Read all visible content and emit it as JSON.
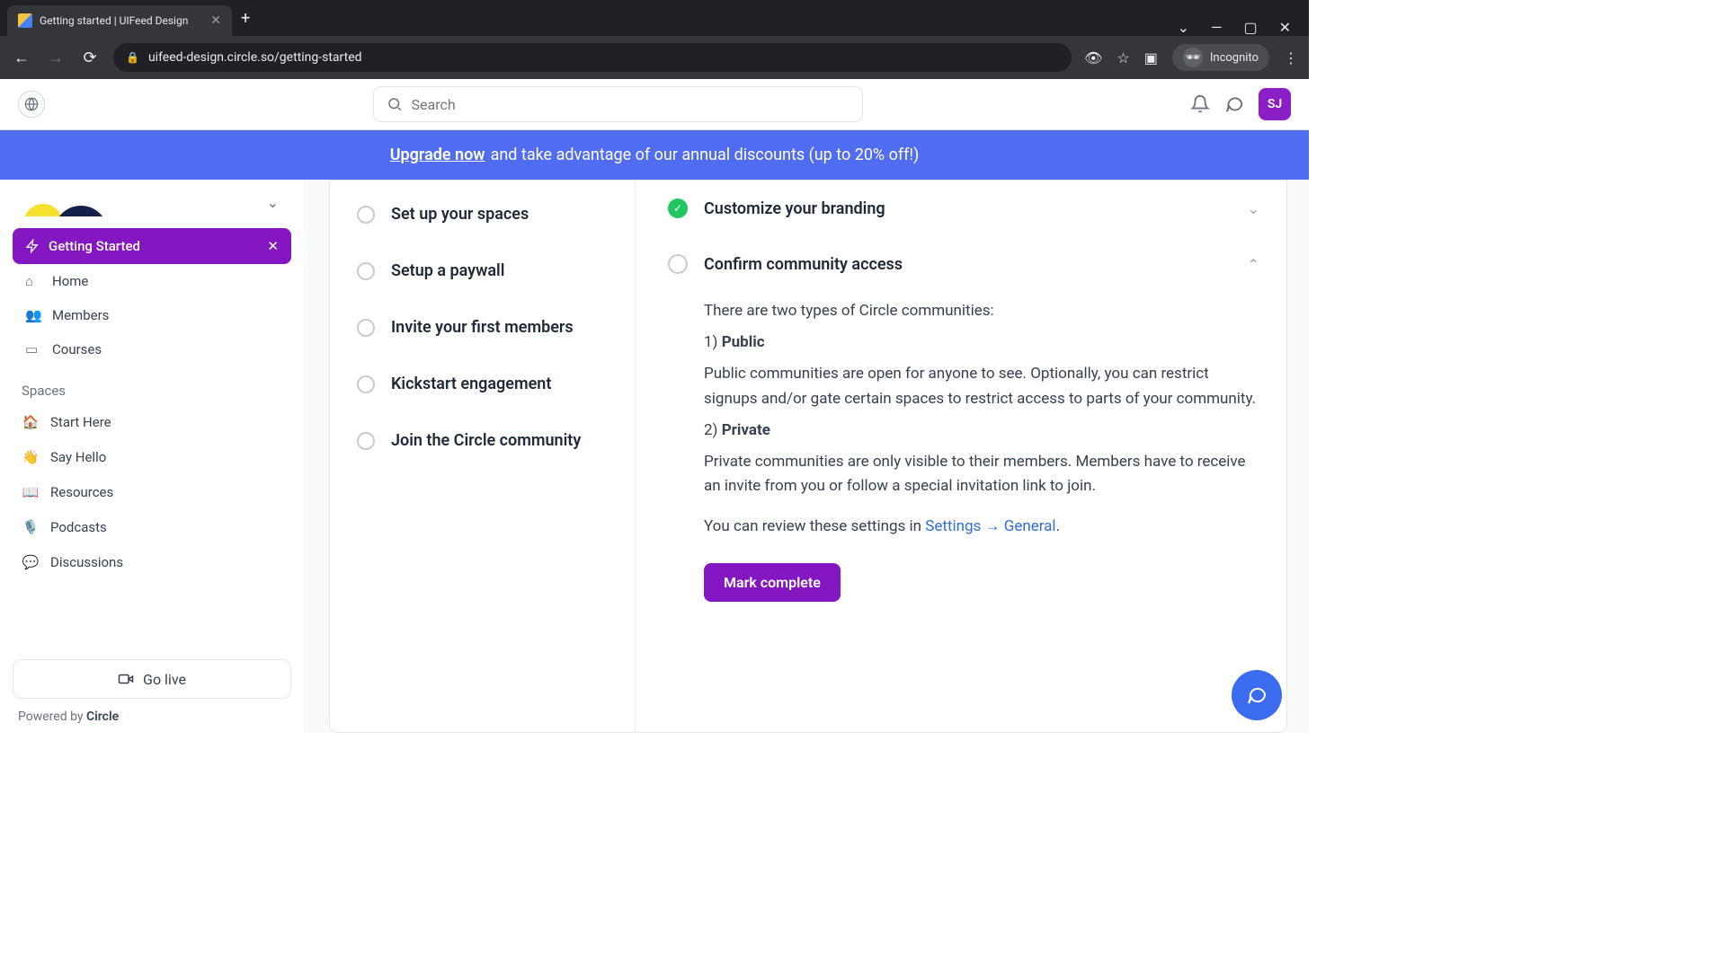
{
  "browser": {
    "tab_title": "Getting started | UIFeed Design",
    "url": "uifeed-design.circle.so/getting-started",
    "incognito_label": "Incognito"
  },
  "header": {
    "search_placeholder": "Search",
    "avatar_initials": "SJ"
  },
  "banner": {
    "link_text": "Upgrade now",
    "rest": " and take advantage of our annual discounts (up to 20% off!)"
  },
  "sidebar": {
    "getting_started": "Getting Started",
    "nav": [
      {
        "icon": "⌂",
        "label": "Home"
      },
      {
        "icon": "👥",
        "label": "Members"
      },
      {
        "icon": "▭",
        "label": "Courses"
      }
    ],
    "spaces_title": "Spaces",
    "spaces": [
      {
        "emoji": "🏠",
        "label": "Start Here"
      },
      {
        "emoji": "👋",
        "label": "Say Hello"
      },
      {
        "emoji": "📖",
        "label": "Resources"
      },
      {
        "emoji": "🎙️",
        "label": "Podcasts"
      },
      {
        "emoji": "💬",
        "label": "Discussions"
      }
    ],
    "go_live": "Go live",
    "powered_prefix": "Powered by ",
    "powered_brand": "Circle"
  },
  "steps": [
    "Set up your spaces",
    "Setup a paywall",
    "Invite your first members",
    "Kickstart engagement",
    "Join the Circle community"
  ],
  "right": {
    "section_done": "Customize your branding",
    "section_open": "Confirm community access",
    "intro": "There are two types of Circle communities:",
    "p1_num": "1) ",
    "p1_label": "Public",
    "p1_body": "Public communities are open for anyone to see. Optionally, you can restrict signups and/or gate certain spaces to restrict access to parts of your community.",
    "p2_num": "2) ",
    "p2_label": "Private",
    "p2_body": "Private communities are only visible to their members. Members have to receive an invite from you or follow a special invitation link to join.",
    "review_prefix": "You can review these settings in ",
    "review_link": "Settings → General",
    "review_suffix": ".",
    "mark_complete": "Mark complete"
  }
}
